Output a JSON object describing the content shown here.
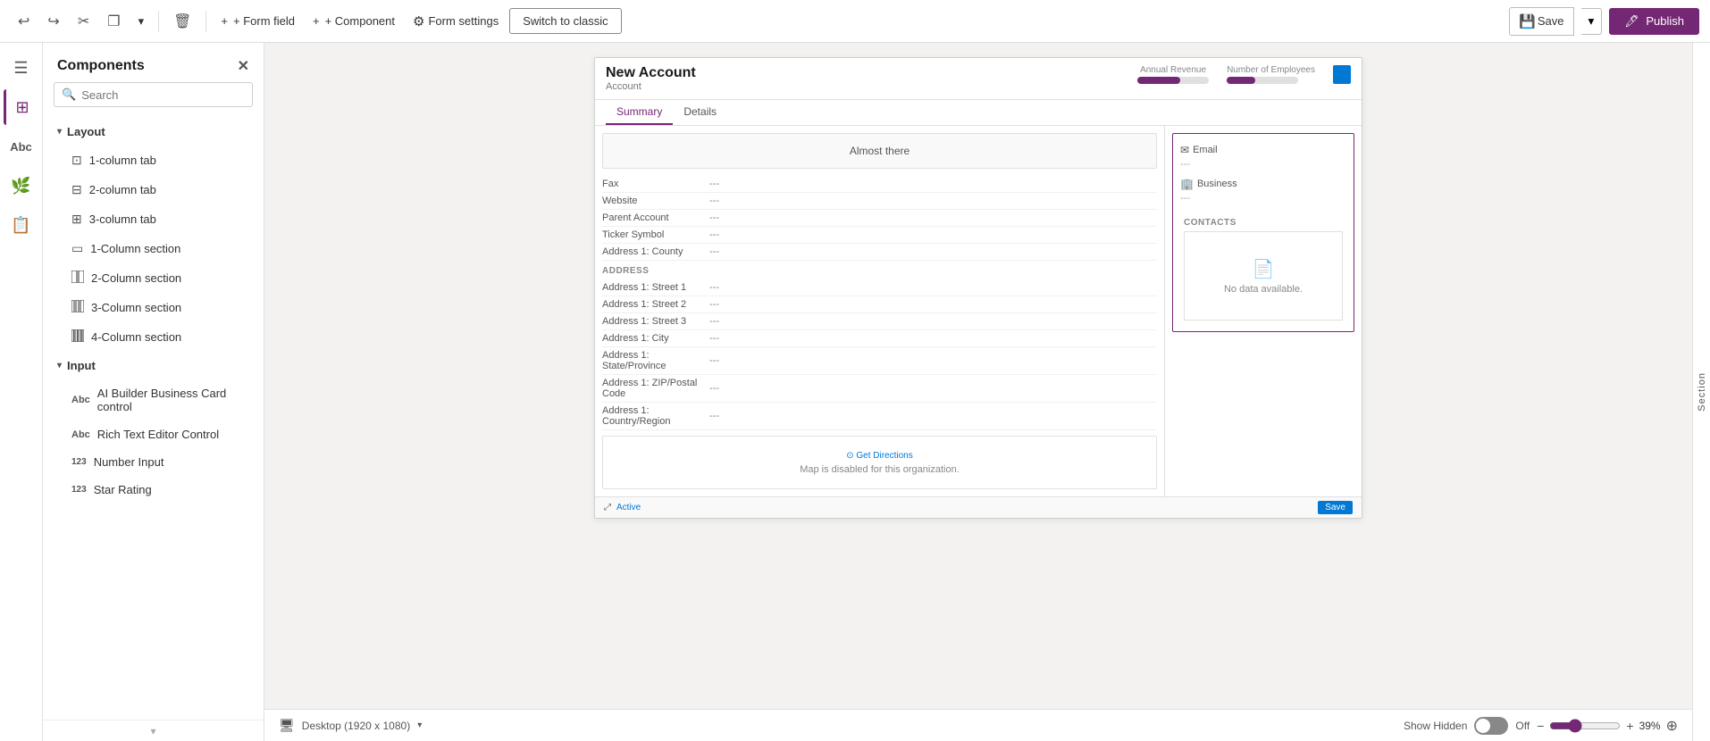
{
  "toolbar": {
    "undo_label": "↩",
    "redo_label": "↪",
    "cut_label": "✂",
    "copy_label": "⎘",
    "dropdown_label": "▾",
    "delete_label": "🗑",
    "form_field_label": "+ Form field",
    "component_label": "+ Component",
    "form_settings_label": "Form settings",
    "switch_classic_label": "Switch to classic",
    "save_label": "Save",
    "publish_label": "Publish"
  },
  "sidebar": {
    "hamburger_icon": "☰",
    "nav_items": [
      {
        "id": "components",
        "label": "Components",
        "icon": "⊞",
        "active": true
      },
      {
        "id": "table-columns",
        "label": "Table columns",
        "icon": "Abc"
      },
      {
        "id": "tree-view",
        "label": "Tree view",
        "icon": "🌿"
      },
      {
        "id": "form-libraries",
        "label": "Form libraries",
        "icon": "📚"
      }
    ]
  },
  "components_panel": {
    "title": "Components",
    "search_placeholder": "Search",
    "close_icon": "✕",
    "layout_section": {
      "label": "Layout",
      "items": [
        {
          "label": "1-column tab",
          "icon": "⊡"
        },
        {
          "label": "2-column tab",
          "icon": "⊟"
        },
        {
          "label": "3-column tab",
          "icon": "⊞"
        },
        {
          "label": "1-Column section",
          "icon": "▭"
        },
        {
          "label": "2-Column section",
          "icon": "⊟"
        },
        {
          "label": "3-Column section",
          "icon": "⊞"
        },
        {
          "label": "4-Column section",
          "icon": "⊟"
        }
      ]
    },
    "input_section": {
      "label": "Input",
      "items": [
        {
          "label": "AI Builder Business Card control",
          "icon": "Abc"
        },
        {
          "label": "Rich Text Editor Control",
          "icon": "Abc"
        },
        {
          "label": "Number Input",
          "icon": "123"
        },
        {
          "label": "Star Rating",
          "icon": "123"
        }
      ]
    }
  },
  "form_preview": {
    "title": "New Account",
    "subtitle": "Account",
    "annual_revenue_label": "Annual Revenue",
    "employees_label": "Number of Employees",
    "metric_bar_fill_pct": 60,
    "tabs": [
      "Summary",
      "Details"
    ],
    "active_tab": "Summary",
    "almost_there": "Almost there",
    "fields_left": [
      {
        "label": "Fax",
        "value": "---"
      },
      {
        "label": "Website",
        "value": "---"
      },
      {
        "label": "Parent Account",
        "value": "---"
      },
      {
        "label": "Ticker Symbol",
        "value": "---"
      },
      {
        "label": "Address 1: County",
        "value": "---"
      }
    ],
    "address_section": "ADDRESS",
    "address_fields": [
      {
        "label": "Address 1: Street 1",
        "value": "---"
      },
      {
        "label": "Address 1: Street 2",
        "value": "---"
      },
      {
        "label": "Address 1: Street 3",
        "value": "---"
      },
      {
        "label": "Address 1: City",
        "value": "---"
      },
      {
        "label": "Address 1: State/Province",
        "value": "---"
      },
      {
        "label": "Address 1: ZIP/Postal Code",
        "value": "---"
      },
      {
        "label": "Address 1: Country/Region",
        "value": "---"
      }
    ],
    "map_disabled": "Map is disabled for this organization.",
    "get_directions": "⊙ Get Directions",
    "status_active": "Active",
    "save_label": "Save",
    "right_section_email_label": "Email",
    "right_section_email_value": "---",
    "right_section_business_label": "Business",
    "right_section_business_value": "---",
    "contacts_label": "CONTACTS",
    "contacts_empty": "No data available."
  },
  "canvas_bottom": {
    "device_icon": "🖥",
    "device_label": "Desktop (1920 x 1080)",
    "show_hidden_label": "Show Hidden",
    "toggle_state": "Off",
    "zoom_minus": "−",
    "zoom_plus": "+",
    "zoom_pct": "39%",
    "fit_icon": "⊕"
  },
  "right_panel": {
    "label": "Section"
  }
}
